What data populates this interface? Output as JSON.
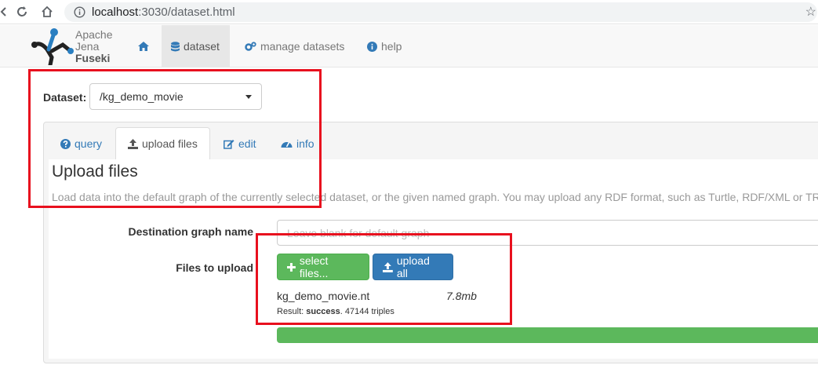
{
  "browser": {
    "url_host": "localhost",
    "url_path": ":3030/dataset.html"
  },
  "brand": {
    "line1": "Apache",
    "line2": "Jena",
    "line3": "Fuseki"
  },
  "nav": {
    "home_icon": "home-icon",
    "items": [
      {
        "label": "dataset",
        "icon": "database-icon",
        "active": true
      },
      {
        "label": "manage datasets",
        "icon": "cogs-icon",
        "active": false
      },
      {
        "label": "help",
        "icon": "info-circle-icon",
        "active": false
      }
    ]
  },
  "dataset": {
    "label": "Dataset:",
    "selected": "/kg_demo_movie"
  },
  "tabs": [
    {
      "label": "query",
      "icon": "question-circle-icon",
      "active": false
    },
    {
      "label": "upload files",
      "icon": "upload-icon",
      "active": true
    },
    {
      "label": "edit",
      "icon": "edit-icon",
      "active": false
    },
    {
      "label": "info",
      "icon": "dashboard-icon",
      "active": false
    }
  ],
  "upload": {
    "title": "Upload files",
    "description": "Load data into the default graph of the currently selected dataset, or the given named graph. You may upload any RDF format, such as Turtle, RDF/XML or TR",
    "dest_label": "Destination graph name",
    "dest_placeholder": "Leave blank for default graph",
    "files_label": "Files to upload",
    "select_button": "select files...",
    "upload_button": "upload all",
    "file": {
      "name": "kg_demo_movie.nt",
      "size": "7.8mb",
      "result_prefix": "Result: ",
      "result_status": "success",
      "result_suffix": ". 47144 triples",
      "progress": 1.0
    }
  },
  "colors": {
    "accent": "#337ab7",
    "success": "#5cb85c",
    "annotation": "#e8101e"
  }
}
